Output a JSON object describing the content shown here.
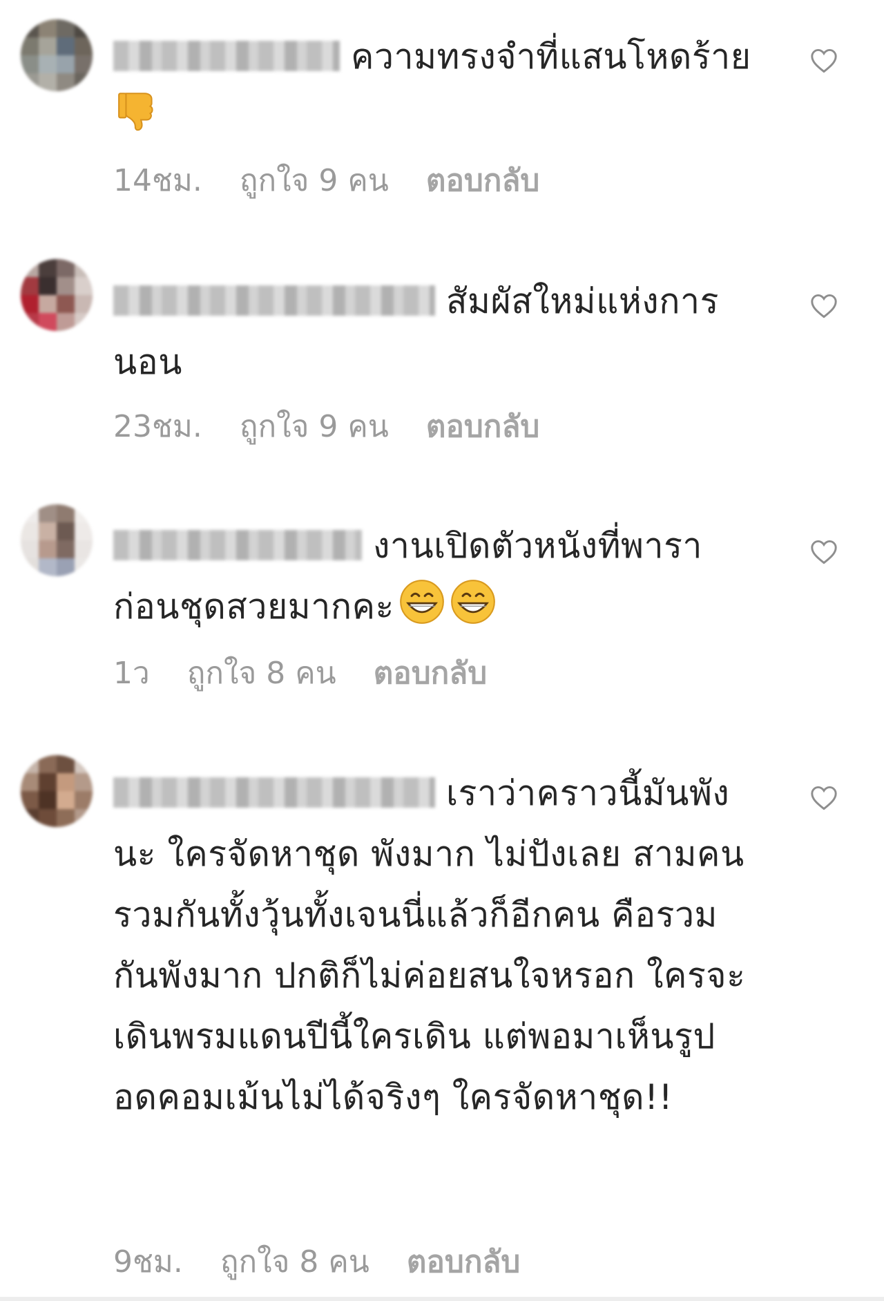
{
  "comments": [
    {
      "text": "ความทรงจำที่แสนโหดร้าย",
      "time": "14ชม.",
      "likes": "ถูกใจ 9 คน",
      "reply": "ตอบกลับ",
      "emoji": "thumbs-down"
    },
    {
      "text": "สัมผัสใหม่แห่งการนอน",
      "time": "23ชม.",
      "likes": "ถูกใจ 9 คน",
      "reply": "ตอบกลับ",
      "emoji": ""
    },
    {
      "text": "งานเปิดตัวหนังที่พาราก่อนชุดสวยมากคะ",
      "time": "1ว",
      "likes": "ถูกใจ 8 คน",
      "reply": "ตอบกลับ",
      "emoji": "grinning-face x2"
    },
    {
      "text": "เราว่าคราวนี้มันพังนะ ใครจัดหาชุด พังมาก ไม่ปังเลย สามคนรวมกันทั้งวุ้นทั้งเจนนี่แล้วก็อีกคน คือรวมกันพังมาก ปกติก็ไม่ค่อยสนใจหรอก ใครจะเดินพรมแดนปีนี้ใครเดิน แต่พอมาเห็นรูป อดคอมเม้นไม่ได้จริงๆ ใครจัดหาชุด!!",
      "time": "9ชม.",
      "likes": "ถูกใจ 8 คน",
      "reply": "ตอบกลับ",
      "emoji": ""
    }
  ],
  "icons": {
    "like": "heart-outline-icon",
    "avatar": "blurred-avatar"
  },
  "colors": {
    "text": "#262626",
    "meta": "#9a9a9a",
    "heart": "#8e8e8e",
    "emoji_yellow": "#f5b431"
  }
}
